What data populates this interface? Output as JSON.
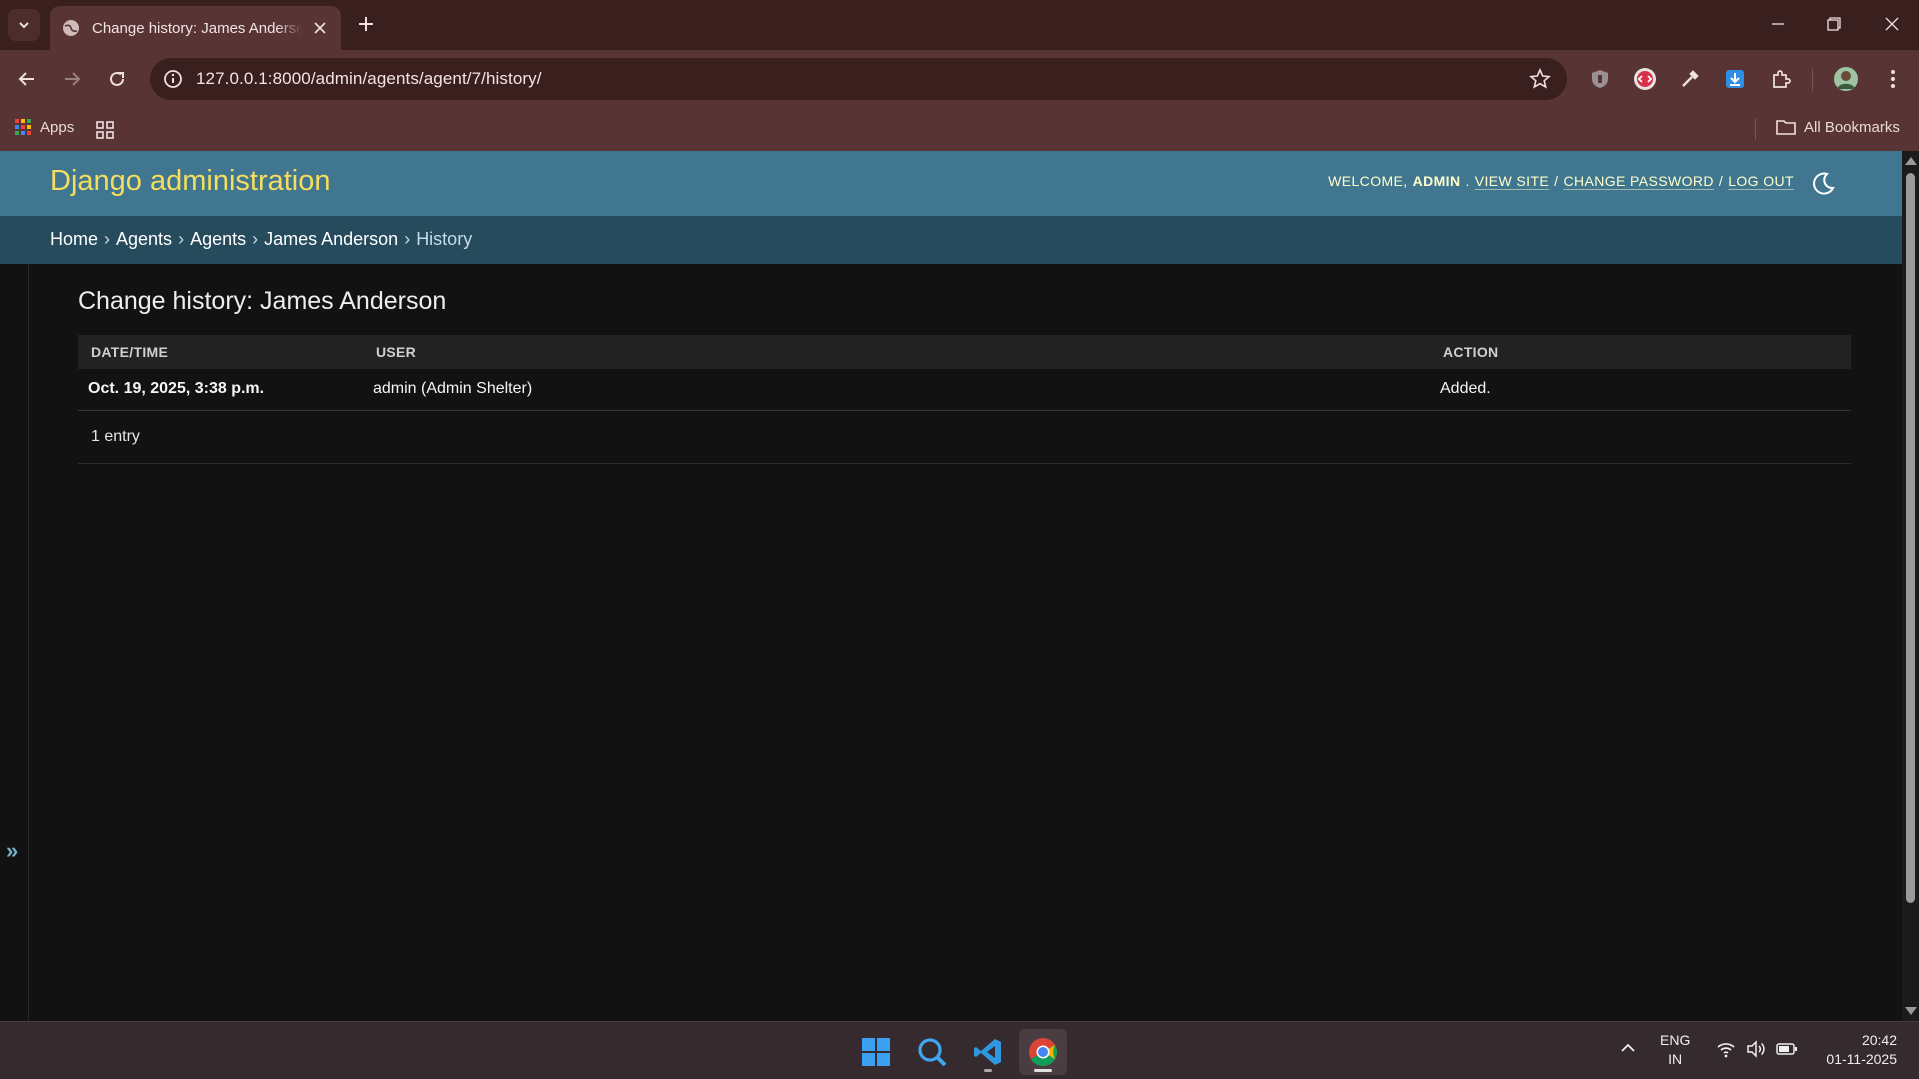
{
  "browser": {
    "tab_title": "Change history: James Anderson",
    "url": "127.0.0.1:8000/admin/agents/agent/7/history/",
    "bookmarks": {
      "apps_label": "Apps",
      "all_bookmarks_label": "All Bookmarks"
    }
  },
  "header": {
    "branding": "Django administration",
    "welcome": "WELCOME,",
    "username": "ADMIN",
    "view_site": "VIEW SITE",
    "change_password": "CHANGE PASSWORD",
    "log_out": "LOG OUT",
    "separator": "/"
  },
  "breadcrumbs": {
    "items": [
      "Home",
      "Agents",
      "Agents",
      "James Anderson"
    ],
    "current": "History",
    "separator": "›"
  },
  "sidebar": {
    "toggle": "»"
  },
  "main": {
    "title": "Change history: James Anderson",
    "columns": [
      "DATE/TIME",
      "USER",
      "ACTION"
    ],
    "rows": [
      {
        "datetime": "Oct. 19, 2025, 3:38 p.m.",
        "user": "admin (Admin Shelter)",
        "action": "Added."
      }
    ],
    "paginator": "1 entry"
  },
  "taskbar": {
    "language": "ENG",
    "region": "IN",
    "time": "20:42",
    "date": "01-11-2025"
  },
  "colors": {
    "header_bg": "#417690",
    "breadcrumb_bg": "#264b5d",
    "branding": "#f5dd5d",
    "page_bg": "#121212"
  }
}
